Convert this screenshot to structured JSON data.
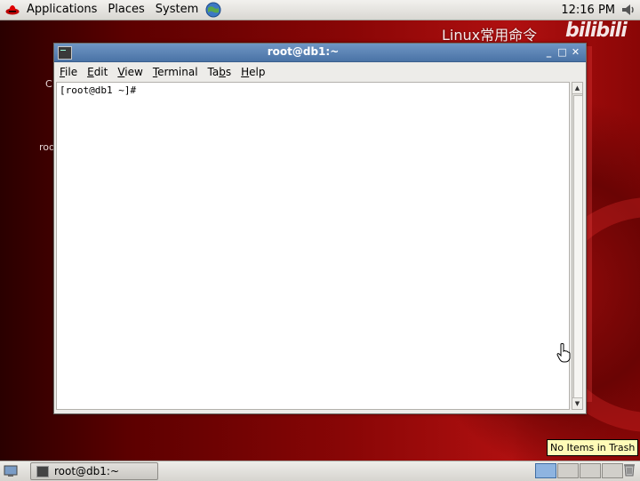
{
  "top_panel": {
    "menus": [
      "Applications",
      "Places",
      "System"
    ],
    "clock": "12:16 PM"
  },
  "watermark": {
    "text": "Linux常用命令",
    "logo": "bilibili"
  },
  "desktop": {
    "icon_labels": [
      "C",
      "roo"
    ]
  },
  "window": {
    "title": "root@db1:~",
    "menubar": [
      {
        "label": "File",
        "mnemonic": "F"
      },
      {
        "label": "Edit",
        "mnemonic": "E"
      },
      {
        "label": "View",
        "mnemonic": "V"
      },
      {
        "label": "Terminal",
        "mnemonic": "T"
      },
      {
        "label": "Tabs",
        "mnemonic": "b"
      },
      {
        "label": "Help",
        "mnemonic": "H"
      }
    ],
    "prompt": "[root@db1 ~]#"
  },
  "bottom_panel": {
    "task_label": "root@db1:~",
    "tooltip": "No Items in Trash"
  },
  "colors": {
    "titlebar": "#4a73a6",
    "desktop": "#8a0606",
    "panel": "#d9d7d2"
  }
}
